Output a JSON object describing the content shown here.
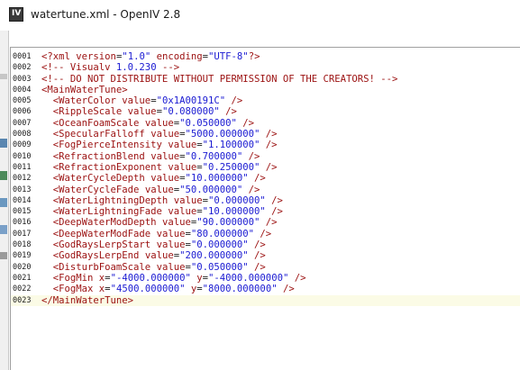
{
  "window": {
    "title": "watertune.xml - OpenIV 2.8",
    "icon_label": "IV",
    "icon_name": "openiv-app-icon"
  },
  "editor": {
    "current_line": 23,
    "lines": [
      {
        "num": "0001",
        "tokens": [
          {
            "t": "<?xml ",
            "k": "tag"
          },
          {
            "t": "version",
            "k": "attr"
          },
          {
            "t": "=",
            "k": "txt"
          },
          {
            "t": "\"1.0\"",
            "k": "val"
          },
          {
            "t": " ",
            "k": "txt"
          },
          {
            "t": "encoding",
            "k": "attr"
          },
          {
            "t": "=",
            "k": "txt"
          },
          {
            "t": "\"UTF-8\"",
            "k": "val"
          },
          {
            "t": "?>",
            "k": "tag"
          }
        ]
      },
      {
        "num": "0002",
        "tokens": [
          {
            "t": "<!-- Visualv ",
            "k": "comment"
          },
          {
            "t": "1.0.230",
            "k": "val"
          },
          {
            "t": " -->",
            "k": "comment"
          }
        ]
      },
      {
        "num": "0003",
        "tokens": [
          {
            "t": "<!-- DO NOT DISTRIBUTE WITHOUT PERMISSION OF THE CREATORS! -->",
            "k": "comment"
          }
        ]
      },
      {
        "num": "0004",
        "tokens": [
          {
            "t": "<MainWaterTune>",
            "k": "tag"
          }
        ]
      },
      {
        "num": "0005",
        "tokens": [
          {
            "t": "  <WaterColor ",
            "k": "tag"
          },
          {
            "t": "value",
            "k": "attr"
          },
          {
            "t": "=",
            "k": "txt"
          },
          {
            "t": "\"0x1A00191C\"",
            "k": "val"
          },
          {
            "t": " />",
            "k": "tag"
          }
        ]
      },
      {
        "num": "0006",
        "tokens": [
          {
            "t": "  <RippleScale ",
            "k": "tag"
          },
          {
            "t": "value",
            "k": "attr"
          },
          {
            "t": "=",
            "k": "txt"
          },
          {
            "t": "\"0.080000\"",
            "k": "val"
          },
          {
            "t": " />",
            "k": "tag"
          }
        ]
      },
      {
        "num": "0007",
        "tokens": [
          {
            "t": "  <OceanFoamScale ",
            "k": "tag"
          },
          {
            "t": "value",
            "k": "attr"
          },
          {
            "t": "=",
            "k": "txt"
          },
          {
            "t": "\"0.050000\"",
            "k": "val"
          },
          {
            "t": " />",
            "k": "tag"
          }
        ]
      },
      {
        "num": "0008",
        "tokens": [
          {
            "t": "  <SpecularFalloff ",
            "k": "tag"
          },
          {
            "t": "value",
            "k": "attr"
          },
          {
            "t": "=",
            "k": "txt"
          },
          {
            "t": "\"5000.000000\"",
            "k": "val"
          },
          {
            "t": " />",
            "k": "tag"
          }
        ]
      },
      {
        "num": "0009",
        "tokens": [
          {
            "t": "  <FogPierceIntensity ",
            "k": "tag"
          },
          {
            "t": "value",
            "k": "attr"
          },
          {
            "t": "=",
            "k": "txt"
          },
          {
            "t": "\"1.100000\"",
            "k": "val"
          },
          {
            "t": " />",
            "k": "tag"
          }
        ]
      },
      {
        "num": "0010",
        "tokens": [
          {
            "t": "  <RefractionBlend ",
            "k": "tag"
          },
          {
            "t": "value",
            "k": "attr"
          },
          {
            "t": "=",
            "k": "txt"
          },
          {
            "t": "\"0.700000\"",
            "k": "val"
          },
          {
            "t": " />",
            "k": "tag"
          }
        ]
      },
      {
        "num": "0011",
        "tokens": [
          {
            "t": "  <RefractionExponent ",
            "k": "tag"
          },
          {
            "t": "value",
            "k": "attr"
          },
          {
            "t": "=",
            "k": "txt"
          },
          {
            "t": "\"0.250000\"",
            "k": "val"
          },
          {
            "t": " />",
            "k": "tag"
          }
        ]
      },
      {
        "num": "0012",
        "tokens": [
          {
            "t": "  <WaterCycleDepth ",
            "k": "tag"
          },
          {
            "t": "value",
            "k": "attr"
          },
          {
            "t": "=",
            "k": "txt"
          },
          {
            "t": "\"10.000000\"",
            "k": "val"
          },
          {
            "t": " />",
            "k": "tag"
          }
        ]
      },
      {
        "num": "0013",
        "tokens": [
          {
            "t": "  <WaterCycleFade ",
            "k": "tag"
          },
          {
            "t": "value",
            "k": "attr"
          },
          {
            "t": "=",
            "k": "txt"
          },
          {
            "t": "\"50.000000\"",
            "k": "val"
          },
          {
            "t": " />",
            "k": "tag"
          }
        ]
      },
      {
        "num": "0014",
        "tokens": [
          {
            "t": "  <WaterLightningDepth ",
            "k": "tag"
          },
          {
            "t": "value",
            "k": "attr"
          },
          {
            "t": "=",
            "k": "txt"
          },
          {
            "t": "\"0.000000\"",
            "k": "val"
          },
          {
            "t": " />",
            "k": "tag"
          }
        ]
      },
      {
        "num": "0015",
        "tokens": [
          {
            "t": "  <WaterLightningFade ",
            "k": "tag"
          },
          {
            "t": "value",
            "k": "attr"
          },
          {
            "t": "=",
            "k": "txt"
          },
          {
            "t": "\"10.000000\"",
            "k": "val"
          },
          {
            "t": " />",
            "k": "tag"
          }
        ]
      },
      {
        "num": "0016",
        "tokens": [
          {
            "t": "  <DeepWaterModDepth ",
            "k": "tag"
          },
          {
            "t": "value",
            "k": "attr"
          },
          {
            "t": "=",
            "k": "txt"
          },
          {
            "t": "\"90.000000\"",
            "k": "val"
          },
          {
            "t": " />",
            "k": "tag"
          }
        ]
      },
      {
        "num": "0017",
        "tokens": [
          {
            "t": "  <DeepWaterModFade ",
            "k": "tag"
          },
          {
            "t": "value",
            "k": "attr"
          },
          {
            "t": "=",
            "k": "txt"
          },
          {
            "t": "\"80.000000\"",
            "k": "val"
          },
          {
            "t": " />",
            "k": "tag"
          }
        ]
      },
      {
        "num": "0018",
        "tokens": [
          {
            "t": "  <GodRaysLerpStart ",
            "k": "tag"
          },
          {
            "t": "value",
            "k": "attr"
          },
          {
            "t": "=",
            "k": "txt"
          },
          {
            "t": "\"0.000000\"",
            "k": "val"
          },
          {
            "t": " />",
            "k": "tag"
          }
        ]
      },
      {
        "num": "0019",
        "tokens": [
          {
            "t": "  <GodRaysLerpEnd ",
            "k": "tag"
          },
          {
            "t": "value",
            "k": "attr"
          },
          {
            "t": "=",
            "k": "txt"
          },
          {
            "t": "\"200.000000\"",
            "k": "val"
          },
          {
            "t": " />",
            "k": "tag"
          }
        ]
      },
      {
        "num": "0020",
        "tokens": [
          {
            "t": "  <DisturbFoamScale ",
            "k": "tag"
          },
          {
            "t": "value",
            "k": "attr"
          },
          {
            "t": "=",
            "k": "txt"
          },
          {
            "t": "\"0.050000\"",
            "k": "val"
          },
          {
            "t": " />",
            "k": "tag"
          }
        ]
      },
      {
        "num": "0021",
        "tokens": [
          {
            "t": "  <FogMin ",
            "k": "tag"
          },
          {
            "t": "x",
            "k": "attr"
          },
          {
            "t": "=",
            "k": "txt"
          },
          {
            "t": "\"-4000.000000\"",
            "k": "val"
          },
          {
            "t": " ",
            "k": "txt"
          },
          {
            "t": "y",
            "k": "attr"
          },
          {
            "t": "=",
            "k": "txt"
          },
          {
            "t": "\"-4000.000000\"",
            "k": "val"
          },
          {
            "t": " />",
            "k": "tag"
          }
        ]
      },
      {
        "num": "0022",
        "tokens": [
          {
            "t": "  <FogMax ",
            "k": "tag"
          },
          {
            "t": "x",
            "k": "attr"
          },
          {
            "t": "=",
            "k": "txt"
          },
          {
            "t": "\"4500.000000\"",
            "k": "val"
          },
          {
            "t": " ",
            "k": "txt"
          },
          {
            "t": "y",
            "k": "attr"
          },
          {
            "t": "=",
            "k": "txt"
          },
          {
            "t": "\"8000.000000\"",
            "k": "val"
          },
          {
            "t": " />",
            "k": "tag"
          }
        ]
      },
      {
        "num": "0023",
        "tokens": [
          {
            "t": "</MainWaterTune>",
            "k": "tag"
          }
        ]
      }
    ]
  },
  "colors": {
    "tag": "#9b1010",
    "value": "#1a1ad2",
    "current_line_bg": "#fbfbe6"
  }
}
